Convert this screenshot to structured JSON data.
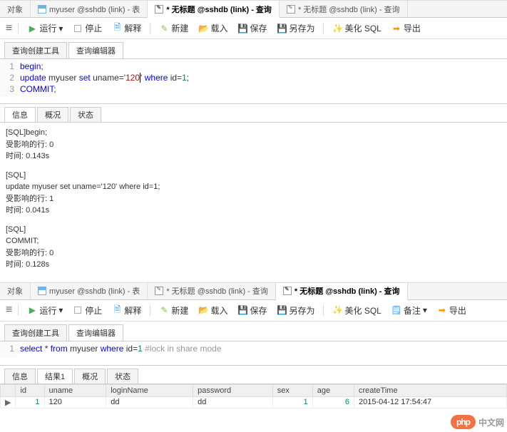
{
  "top": {
    "tabs": [
      {
        "label": "对象"
      },
      {
        "label": "myuser @sshdb (link) - 表"
      },
      {
        "label": "* 无标题 @sshdb (link) - 查询",
        "active": true
      },
      {
        "label": "* 无标题 @sshdb (link) - 查询"
      }
    ],
    "toolbar": {
      "run": "运行",
      "stop": "停止",
      "explain": "解释",
      "new": "新建",
      "load": "载入",
      "save": "保存",
      "saveas": "另存为",
      "beautify": "美化 SQL",
      "export": "导出"
    },
    "subtabs": {
      "builder": "查询创建工具",
      "editor": "查询编辑器"
    },
    "editor": {
      "lines": [
        {
          "n": "1",
          "html": "<span class='kw'>begin</span>;"
        },
        {
          "n": "2",
          "html": "<span class='kw'>update</span> myuser <span class='kw'>set</span> uname=<span class='str'>'120</span><span class='cursor'></span><span class='str'>'</span> <span class='kw'>where</span> id=<span class='num'>1</span>;"
        },
        {
          "n": "3",
          "html": "<span class='kw'>COMMIT</span>;"
        }
      ]
    },
    "result_tabs": [
      "信息",
      "概况",
      "状态"
    ],
    "messages": [
      [
        "[SQL]begin;",
        "受影响的行: 0",
        "时间: 0.143s"
      ],
      [
        "[SQL]",
        "update myuser set uname='120' where id=1;",
        "受影响的行: 1",
        "时间: 0.041s"
      ],
      [
        "[SQL]",
        "COMMIT;",
        "受影响的行: 0",
        "时间: 0.128s"
      ]
    ]
  },
  "bottom": {
    "tabs": [
      {
        "label": "对象"
      },
      {
        "label": "myuser @sshdb (link) - 表"
      },
      {
        "label": "* 无标题 @sshdb (link) - 查询"
      },
      {
        "label": "* 无标题 @sshdb (link) - 查询",
        "active": true
      }
    ],
    "toolbar": {
      "run": "运行",
      "stop": "停止",
      "explain": "解释",
      "new": "新建",
      "load": "载入",
      "save": "保存",
      "saveas": "另存为",
      "beautify": "美化 SQL",
      "note": "备注",
      "export": "导出"
    },
    "subtabs": {
      "builder": "查询创建工具",
      "editor": "查询编辑器"
    },
    "editor": {
      "lines": [
        {
          "n": "1",
          "html": "<span class='kw'>select</span> * <span class='kw'>from</span> myuser <span class='kw'>where</span> id=<span class='num'>1</span> <span class='cmt'>#lock in share mode</span>"
        }
      ]
    },
    "result_tabs": [
      "信息",
      "结果1",
      "概况",
      "状态"
    ],
    "result_active": 1,
    "grid": {
      "cols": [
        "id",
        "uname",
        "loginName",
        "password",
        "sex",
        "age",
        "createTime"
      ],
      "rows": [
        {
          "id": "1",
          "uname": "120",
          "loginName": "dd",
          "password": "dd",
          "sex": "1",
          "age": "6",
          "createTime": "2015-04-12 17:54:47"
        }
      ]
    }
  },
  "watermark": {
    "logo": "php",
    "text": "中文网"
  }
}
